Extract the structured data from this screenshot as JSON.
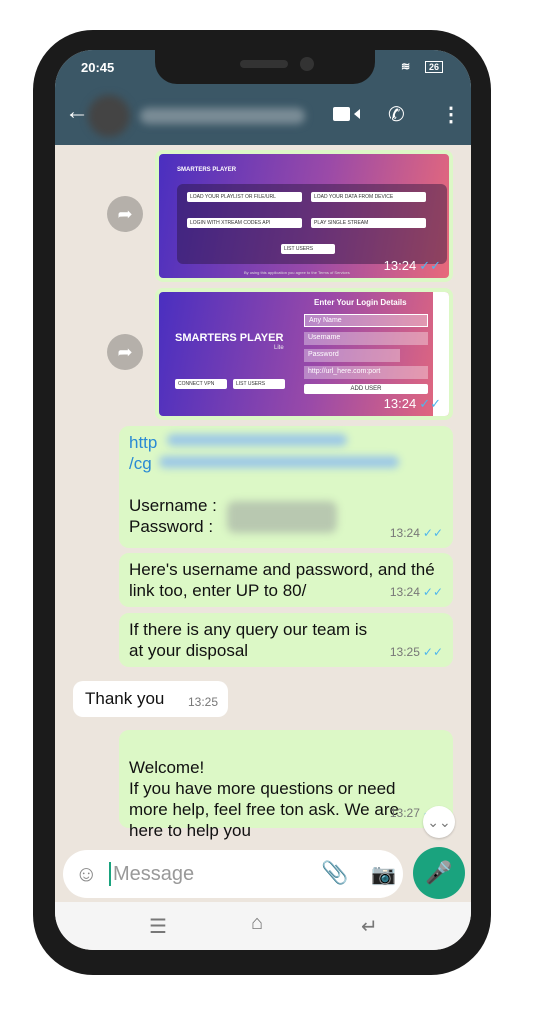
{
  "status": {
    "time": "20:45",
    "battery": "26"
  },
  "header": {
    "back": "←",
    "video": "video-icon",
    "call": "phone-icon",
    "menu": "⋮"
  },
  "images": [
    {
      "brand": "SMARTERS PLAYER",
      "buttons": [
        "LOAD YOUR PLAYLIST OR FILE/URL",
        "LOAD YOUR DATA FROM DEVICE",
        "LOGIN WITH XTREAM CODES API",
        "PLAY SINGLE STREAM",
        "LIST USERS"
      ],
      "footer": "By using this application you agree to the Terms of Services",
      "time": "13:24"
    },
    {
      "brand": "SMARTERS PLAYER",
      "sub": "Lite",
      "title": "Enter Your Login Details",
      "fields": [
        "Any Name",
        "Username",
        "Password",
        "http://url_here.com:port"
      ],
      "add": "ADD USER",
      "vpn": "CONNECT VPN",
      "list": "LIST USERS",
      "time": "13:24"
    }
  ],
  "messages": [
    {
      "link1": "http",
      "link2": "/cg",
      "username": "Username :",
      "password": "Password  :",
      "time": "13:24"
    },
    {
      "text": "Here's username and password, and thé link too, enter UP to 80/",
      "time": "13:24"
    },
    {
      "text": "If there is any query our team is at your disposal",
      "time": "13:25"
    },
    {
      "text": "Thank you",
      "time": "13:25"
    },
    {
      "text": "Welcome!\nIf you have more questions or need more help, feel free ton ask. We are here to help you",
      "time": "13:27"
    }
  ],
  "input": {
    "placeholder": "Message"
  }
}
